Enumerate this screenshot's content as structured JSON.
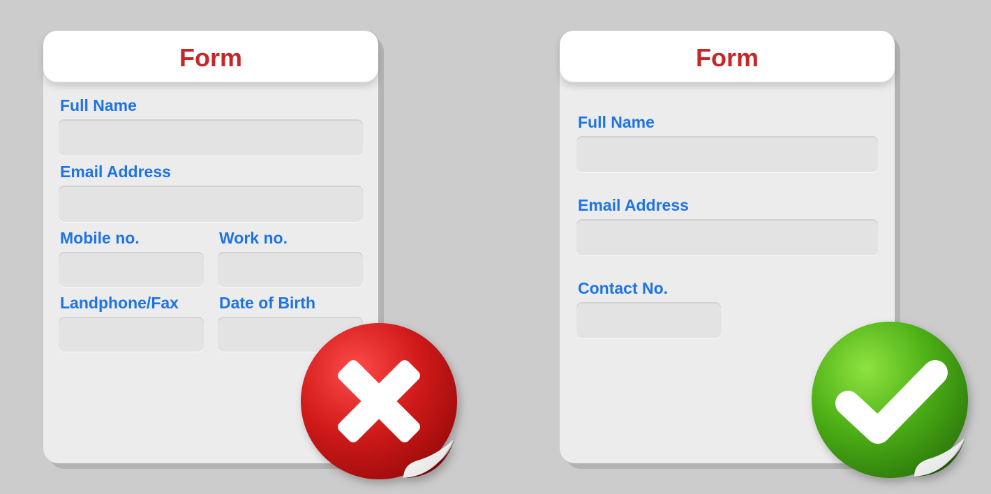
{
  "cards": {
    "bad": {
      "title": "Form",
      "fields": {
        "full_name": "Full Name",
        "email": "Email Address",
        "mobile": "Mobile no.",
        "work": "Work no.",
        "landphone_fax": "Landphone/Fax",
        "dob": "Date of Birth"
      },
      "status": "incorrect"
    },
    "good": {
      "title": "Form",
      "fields": {
        "full_name": "Full Name",
        "email": "Email Address",
        "contact": "Contact No."
      },
      "status": "correct"
    }
  },
  "colors": {
    "label": "#1e73e6",
    "title": "#c62828",
    "bad_badge": "#d11a1a",
    "good_badge": "#4caf16"
  }
}
